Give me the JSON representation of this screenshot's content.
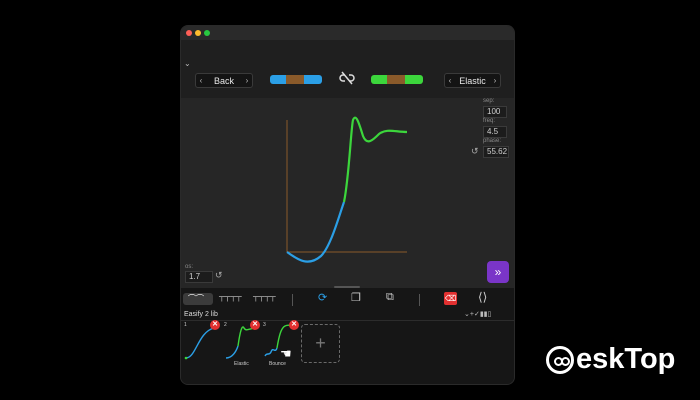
{
  "toolbar": {
    "left_select": "Back",
    "right_select": "Elastic",
    "link_icon": "unlink-icon",
    "left_colors": [
      "#2b9fe6",
      "#8a5a2a",
      "#2b9fe6"
    ],
    "right_colors": [
      "#3cd63c",
      "#8a5a2a",
      "#3cd63c"
    ]
  },
  "params": {
    "sep_label": "sep:",
    "sep_value": "100",
    "freq_label": "freq:",
    "freq_value": "4.5",
    "phase_label": "phase:",
    "phase_value": "55.62",
    "os_label": "os:",
    "os_value": "1.7"
  },
  "bottom_toolbar": {
    "icons": [
      "curve-preset-1-icon",
      "curve-preset-2-icon",
      "curve-preset-3-icon",
      "sync-icon",
      "copy-icon",
      "paste-icon",
      "delete-icon",
      "expand-icon"
    ]
  },
  "library": {
    "title": "Easify 2 lib",
    "items": [
      {
        "index": "1",
        "label": ""
      },
      {
        "index": "2",
        "label": "Elastic"
      },
      {
        "index": "3",
        "label": "Bounce"
      }
    ],
    "add_label": "+"
  },
  "watermark": {
    "text": "esk",
    "text2": "Top"
  },
  "colors": {
    "blue": "#2b9fe6",
    "green": "#3cd63c",
    "brown": "#8a5a2a",
    "purple": "#7a35c8",
    "red": "#e23030"
  }
}
